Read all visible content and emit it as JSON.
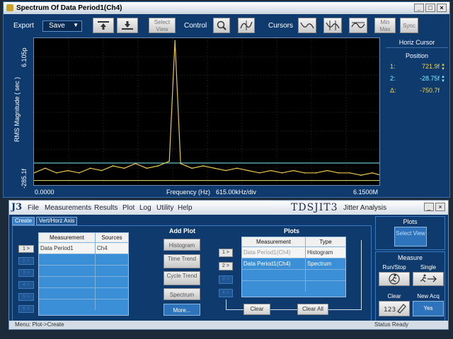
{
  "spectrum_window": {
    "title": "Spectrum Of Data Period1(Ch4)",
    "buttons": {
      "minimize": "_",
      "maximize": "□",
      "close": "×"
    }
  },
  "toolbar": {
    "export_label": "Export",
    "save_value": "Save",
    "select_view": "Select View",
    "control_label": "Control",
    "cursors_label": "Cursors",
    "min_max": "Min Max",
    "sync": "Sync"
  },
  "plot": {
    "y_axis_label": "RMS Magnitude ( sec )",
    "y_top": "6.105p",
    "y_bottom": "-285.1f",
    "x_left": "0.0000",
    "x_right": "6.1500M",
    "x_axis_label": "Frequency (Hz)",
    "x_div": "615.00kHz/div",
    "trace_color": "#e8c64c",
    "cursor1_color": "#e8e86a",
    "cursor2_color": "#7ff0ff"
  },
  "chart_data": {
    "type": "line",
    "xlabel": "Frequency (Hz)",
    "ylabel": "RMS Magnitude ( sec )",
    "xlim": [
      0,
      6150000
    ],
    "ylim": [
      -2.851e-13,
      6.105e-12
    ],
    "series": [
      {
        "x": [
          0,
          200000,
          400000,
          600000,
          800000,
          1000000,
          1200000,
          1400000,
          1600000,
          1800000,
          2000000,
          2200000,
          2400000,
          2500000,
          2600000,
          2700000,
          2800000,
          3000000,
          3200000,
          3400000,
          3600000,
          3800000,
          4000000,
          4200000,
          4400000,
          4600000,
          4800000,
          5000000,
          5200000,
          5400000,
          5600000,
          5800000,
          6000000,
          6150000
        ],
        "values": [
          3e-13,
          5e-13,
          3e-13,
          4e-13,
          3e-13,
          5e-13,
          4e-13,
          6e-13,
          5e-13,
          7e-13,
          5e-13,
          6e-13,
          8e-13,
          6e-12,
          7e-13,
          6e-13,
          5e-13,
          6e-13,
          5e-13,
          4e-13,
          5e-13,
          4e-13,
          3e-13,
          4e-13,
          3e-13,
          4e-13,
          3e-13,
          3e-13,
          4e-13,
          3e-13,
          3e-13,
          2e-13,
          3e-13,
          2e-13
        ]
      }
    ],
    "grid": true
  },
  "horz_cursor": {
    "title": "Horiz Cursor",
    "subtitle": "Position",
    "rows": [
      {
        "key": "1:",
        "value": "721.9f"
      },
      {
        "key": "2:",
        "value": "-28.75f"
      },
      {
        "key": "Δ:",
        "value": "-750.7f"
      }
    ]
  },
  "j3": {
    "logo": "J3",
    "menu": [
      "File",
      "Measurements",
      "Results",
      "Plot",
      "Log",
      "Utility",
      "Help"
    ],
    "brand": "TDSJIT3",
    "brand_sub": "Jitter Analysis",
    "window_buttons": {
      "minimize": "_",
      "close": "×"
    },
    "tabs": [
      "Create",
      "Vert/Horz Axis"
    ],
    "row_buttons": [
      "1 >",
      "2 >",
      "3 >",
      "4 >",
      "5 >",
      "6 >"
    ],
    "meas_table": {
      "headers": [
        "Measurement",
        "Sources"
      ],
      "rows": [
        [
          "Data Period1",
          "Ch4"
        ],
        [
          "",
          ""
        ],
        [
          "",
          ""
        ],
        [
          "",
          ""
        ],
        [
          "",
          ""
        ],
        [
          "",
          ""
        ]
      ]
    },
    "add_plot": {
      "title": "Add Plot",
      "buttons": [
        "Histogram",
        "Time Trend",
        "Cycle Trend",
        "Spectrum",
        "More..."
      ]
    },
    "plots": {
      "title": "Plots",
      "row_buttons": [
        "1 >",
        "2 >",
        "3 >",
        "4 >"
      ],
      "headers": [
        "Measurement",
        "Type"
      ],
      "rows": [
        [
          "Data Period1(Ch4)",
          "Histogram"
        ],
        [
          "Data Period1(Ch4)",
          "Spectrum"
        ],
        [
          "",
          ""
        ],
        [
          "",
          ""
        ]
      ],
      "clear": "Clear",
      "clear_all": "Clear All"
    },
    "plots_side": {
      "title": "Plots",
      "select_view": "Select View"
    },
    "measure_side": {
      "title": "Measure",
      "run_stop": "Run/Stop",
      "single": "Single",
      "clear": "Clear",
      "new_acq": "New Acq",
      "yes": "Yes"
    },
    "status_left": "Menu: Plot->Create",
    "status_right": "Status  Ready"
  }
}
